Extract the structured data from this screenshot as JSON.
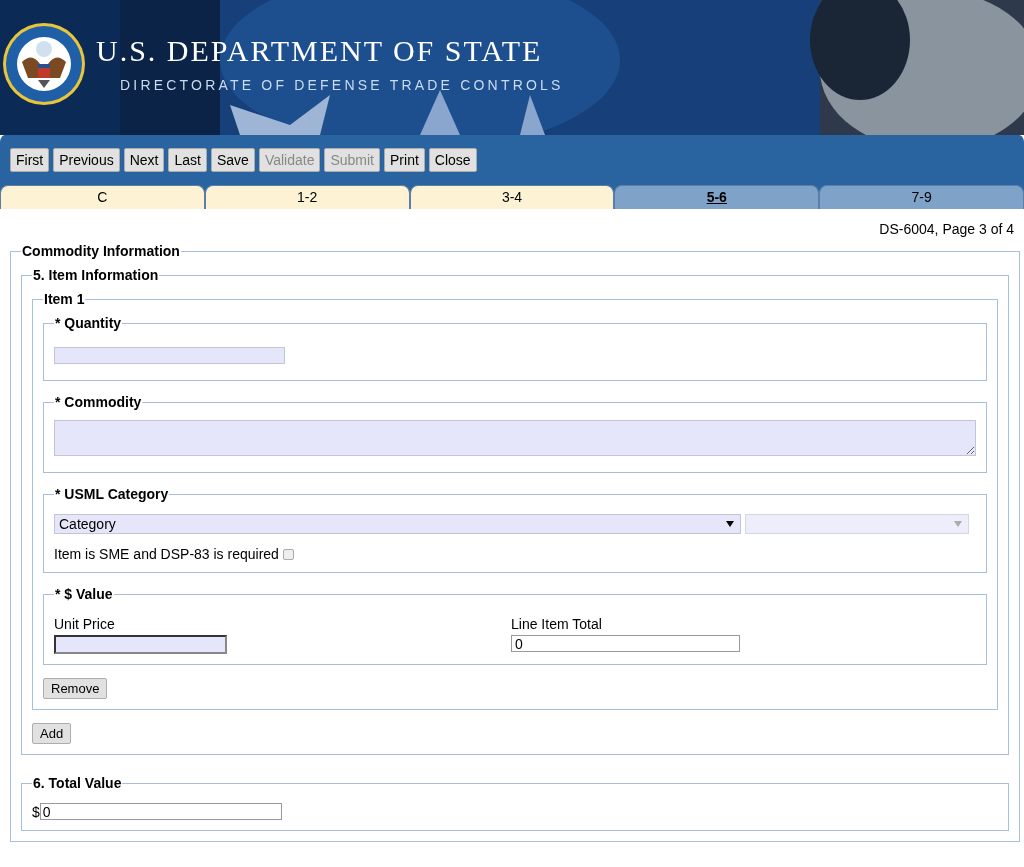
{
  "header": {
    "title": "U.S. DEPARTMENT OF STATE",
    "subtitle": "DIRECTORATE OF DEFENSE TRADE CONTROLS"
  },
  "toolbar": [
    {
      "label": "First",
      "disabled": false
    },
    {
      "label": "Previous",
      "disabled": false
    },
    {
      "label": "Next",
      "disabled": false
    },
    {
      "label": "Last",
      "disabled": false
    },
    {
      "label": "Save",
      "disabled": false
    },
    {
      "label": "Validate",
      "disabled": true
    },
    {
      "label": "Submit",
      "disabled": true
    },
    {
      "label": "Print",
      "disabled": false
    },
    {
      "label": "Close",
      "disabled": false
    }
  ],
  "tabs": [
    {
      "label": "C",
      "selected": false,
      "completed": true
    },
    {
      "label": "1-2",
      "selected": false,
      "completed": true
    },
    {
      "label": "3-4",
      "selected": false,
      "completed": true
    },
    {
      "label": "5-6",
      "selected": true,
      "completed": false
    },
    {
      "label": "7-9",
      "selected": false,
      "completed": false
    }
  ],
  "page_label": "DS-6004, Page 3 of 4",
  "commodity_information": {
    "legend": "Commodity Information",
    "item_information": {
      "legend": "5. Item Information",
      "items": [
        {
          "legend": "Item 1",
          "quantity": {
            "legend": "* Quantity"
          },
          "commodity": {
            "legend": "* Commodity"
          },
          "usml_category": {
            "legend": "* USML Category",
            "category": "Category",
            "sme_label": "Item is SME and DSP-83 is required",
            "sme_checked": false
          },
          "value": {
            "legend": "* $ Value",
            "unit_price_label": "Unit Price",
            "line_total_label": "Line Item Total",
            "line_total": "0"
          },
          "remove_button": "Remove"
        }
      ],
      "add_button": "Add"
    },
    "total_value": {
      "legend": "6. Total Value",
      "currency": "$",
      "value": "0"
    }
  }
}
